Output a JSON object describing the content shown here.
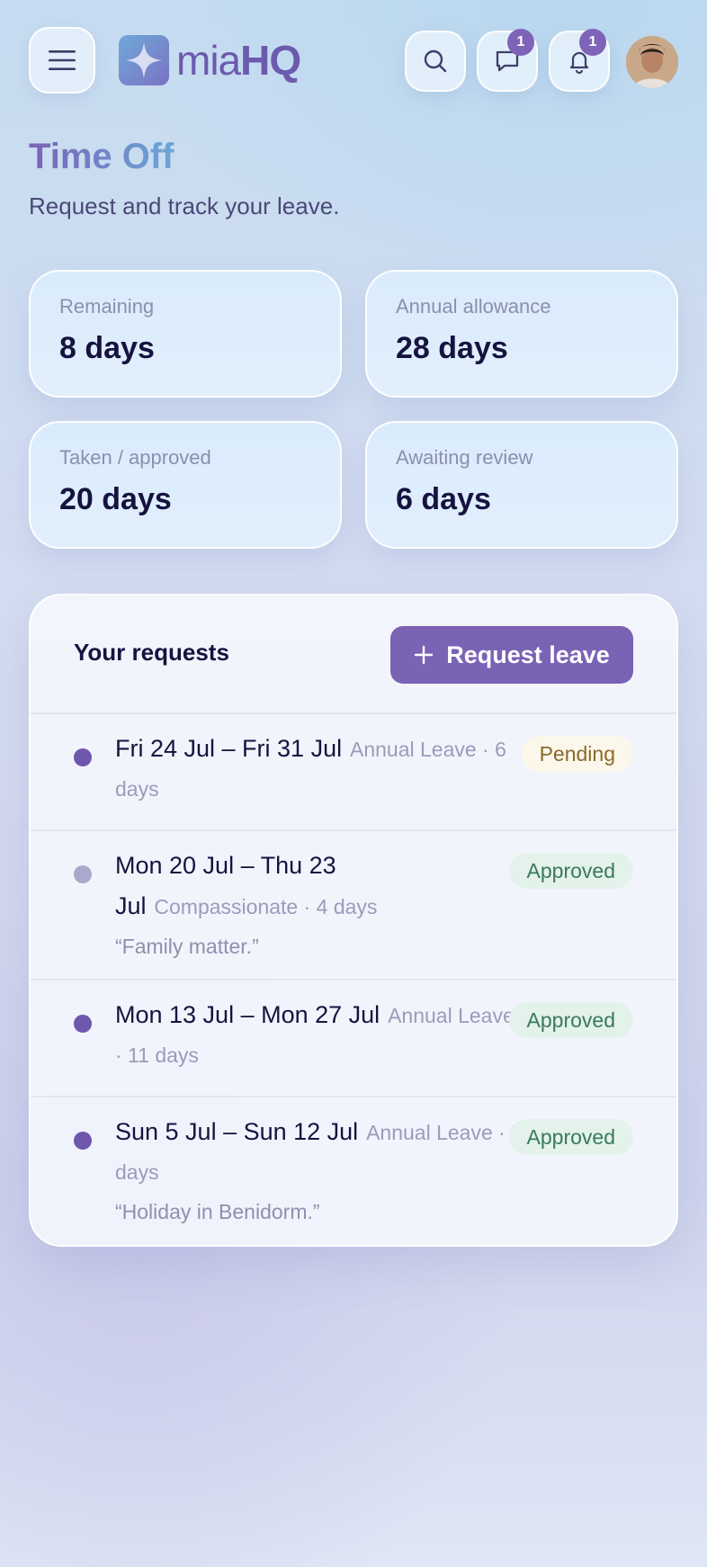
{
  "header": {
    "logo_text_a": "mia",
    "logo_text_b": "HQ",
    "messages_badge": "1",
    "notifications_badge": "1",
    "menu_icon": "hamburger-icon",
    "search_icon": "search-icon",
    "messages_icon": "chat-bubble-icon",
    "notifications_icon": "bell-icon"
  },
  "page": {
    "title": "Time Off",
    "subtitle": "Request and track your leave."
  },
  "stats": [
    {
      "label": "Remaining",
      "value": "8 days"
    },
    {
      "label": "Annual allowance",
      "value": "28 days"
    },
    {
      "label": "Taken / approved",
      "value": "20 days"
    },
    {
      "label": "Awaiting review",
      "value": "6 days"
    }
  ],
  "requests": {
    "title": "Your requests",
    "button_label": "Request leave",
    "items": [
      {
        "dates": "Fri 24 Jul – Fri 31 Jul",
        "meta": "Annual Leave · 6 days",
        "note": "",
        "status": "Pending"
      },
      {
        "dates": "Mon 20 Jul – Thu 23 Jul",
        "meta": "Compassionate · 4 days",
        "note": "“Family matter.”",
        "status": "Approved"
      },
      {
        "dates": "Mon 13 Jul – Mon 27 Jul",
        "meta": "Annual Leave · 11 days",
        "note": "",
        "status": "Approved"
      },
      {
        "dates": "Sun 5 Jul – Sun 12 Jul",
        "meta": "Annual Leave · 5 days",
        "note": "“Holiday in Benidorm.”",
        "status": "Approved"
      }
    ]
  },
  "colors": {
    "accent": "#7a62b4",
    "dot_default": "#6f57ad",
    "dot_muted": "#aca7cc"
  }
}
